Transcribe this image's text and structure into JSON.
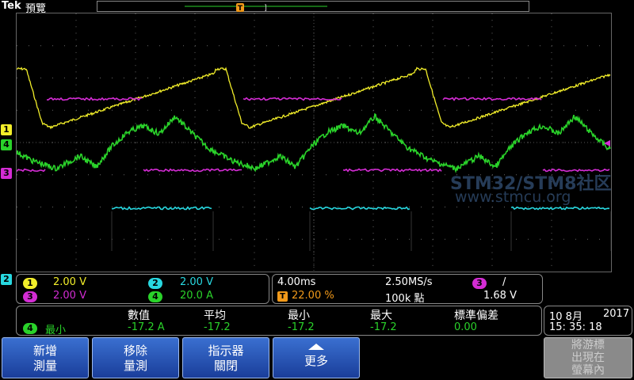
{
  "header": {
    "brand": "Tek",
    "mode": "預覽",
    "trigger_marker": "T"
  },
  "watermark": {
    "line1": "STM32/STM8社区",
    "line2": "www.stmcu.org"
  },
  "markers": {
    "ch1": "1",
    "ch2": "2",
    "ch3": "3",
    "ch4": "4"
  },
  "channels": [
    {
      "id": "1",
      "scale": "2.00 V",
      "color": "#f2ee2a"
    },
    {
      "id": "2",
      "scale": "2.00 V",
      "color": "#28d8e0"
    },
    {
      "id": "3",
      "scale": "2.00 V",
      "color": "#d42cd4"
    },
    {
      "id": "4",
      "scale": "20.0 A",
      "color": "#2ad22a"
    }
  ],
  "timebase": {
    "horizontal": "4.00ms",
    "sample_rate": "2.50MS/s",
    "trigger_pos": "22.00 %",
    "record_length": "100k 點",
    "trigger_source": "3",
    "trigger_slope": "/",
    "trigger_level": "1.68 V"
  },
  "measurement": {
    "headers": [
      "數值",
      "平均",
      "最小",
      "最大",
      "標準偏差"
    ],
    "source": "4",
    "name": "最小",
    "value": "-17.2 A",
    "mean": "-17.2",
    "min": "-17.2",
    "max": "-17.2",
    "std": "0.00"
  },
  "datetime": {
    "date": "10 8月",
    "year": "2017",
    "time": "15: 35: 18"
  },
  "buttons": {
    "add_line1": "新增",
    "add_line2": "測量",
    "remove_line1": "移除",
    "remove_line2": "量測",
    "indicator_line1": "指示器",
    "indicator_line2": "關閉",
    "more": "更多",
    "relocate_line1": "將游標",
    "relocate_line2": "出現在",
    "relocate_line3": "螢幕內"
  }
}
